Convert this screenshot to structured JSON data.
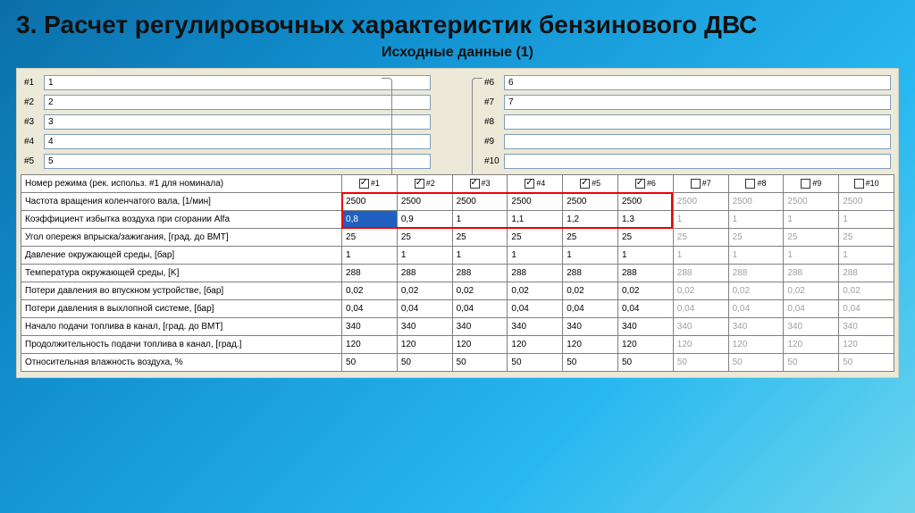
{
  "title": "3. Расчет регулировочных характеристик бензинового ДВС",
  "subtitle": "Исходные данные (1)",
  "left_inputs": [
    {
      "label": "#1",
      "value": "1"
    },
    {
      "label": "#2",
      "value": "2"
    },
    {
      "label": "#3",
      "value": "3"
    },
    {
      "label": "#4",
      "value": "4"
    },
    {
      "label": "#5",
      "value": "5"
    }
  ],
  "right_inputs": [
    {
      "label": "#6",
      "value": "6"
    },
    {
      "label": "#7",
      "value": "7"
    },
    {
      "label": "#8",
      "value": ""
    },
    {
      "label": "#9",
      "value": ""
    },
    {
      "label": "#10",
      "value": ""
    }
  ],
  "columns": [
    {
      "label": "#1",
      "checked": true
    },
    {
      "label": "#2",
      "checked": true
    },
    {
      "label": "#3",
      "checked": true
    },
    {
      "label": "#4",
      "checked": true
    },
    {
      "label": "#5",
      "checked": true
    },
    {
      "label": "#6",
      "checked": true
    },
    {
      "label": "#7",
      "checked": false
    },
    {
      "label": "#8",
      "checked": false
    },
    {
      "label": "#9",
      "checked": false
    },
    {
      "label": "#10",
      "checked": false
    }
  ],
  "rows": [
    {
      "param": "Номер режима (рек. использ. #1 для номинала)",
      "vals": [
        "",
        "",
        "",
        "",
        "",
        "",
        "",
        "",
        "",
        ""
      ],
      "is_header": true
    },
    {
      "param": "Частота вращения коленчатого вала, [1/мин]",
      "vals": [
        "2500",
        "2500",
        "2500",
        "2500",
        "2500",
        "2500",
        "2500",
        "2500",
        "2500",
        "2500"
      ]
    },
    {
      "param": "Коэффициент избытка воздуха при сгорании Alfa",
      "vals": [
        "0,8",
        "0,9",
        "1",
        "1,1",
        "1,2",
        "1,3",
        "1",
        "1",
        "1",
        "1"
      ]
    },
    {
      "param": "Угол опережя впрыска/зажигания, [град. до ВМТ]",
      "vals": [
        "25",
        "25",
        "25",
        "25",
        "25",
        "25",
        "25",
        "25",
        "25",
        "25"
      ]
    },
    {
      "param": "Давление окружающей среды, [бар]",
      "vals": [
        "1",
        "1",
        "1",
        "1",
        "1",
        "1",
        "1",
        "1",
        "1",
        "1"
      ]
    },
    {
      "param": "Температура окружающей среды, [K]",
      "vals": [
        "288",
        "288",
        "288",
        "288",
        "288",
        "288",
        "288",
        "288",
        "288",
        "288"
      ]
    },
    {
      "param": "Потери давления во впускном устройстве, [бар]",
      "vals": [
        "0,02",
        "0,02",
        "0,02",
        "0,02",
        "0,02",
        "0,02",
        "0,02",
        "0,02",
        "0,02",
        "0,02"
      ]
    },
    {
      "param": "Потери давления в выхлопной системе, [бар]",
      "vals": [
        "0,04",
        "0,04",
        "0,04",
        "0,04",
        "0,04",
        "0,04",
        "0,04",
        "0,04",
        "0,04",
        "0,04"
      ]
    },
    {
      "param": "Начало подачи топлива в канал, [град. до ВМТ]",
      "vals": [
        "340",
        "340",
        "340",
        "340",
        "340",
        "340",
        "340",
        "340",
        "340",
        "340"
      ]
    },
    {
      "param": "Продолжительность подачи топлива в канал, [град.]",
      "vals": [
        "120",
        "120",
        "120",
        "120",
        "120",
        "120",
        "120",
        "120",
        "120",
        "120"
      ]
    },
    {
      "param": "Относительная влажность воздуха, %",
      "vals": [
        "50",
        "50",
        "50",
        "50",
        "50",
        "50",
        "50",
        "50",
        "50",
        "50"
      ]
    }
  ],
  "chart_data": {
    "type": "table",
    "title": "Исходные данные (1)",
    "columns": [
      "#1",
      "#2",
      "#3",
      "#4",
      "#5",
      "#6",
      "#7",
      "#8",
      "#9",
      "#10"
    ],
    "active_columns": [
      1,
      2,
      3,
      4,
      5,
      6
    ],
    "series": [
      {
        "name": "Частота вращения коленчатого вала, [1/мин]",
        "values": [
          2500,
          2500,
          2500,
          2500,
          2500,
          2500,
          2500,
          2500,
          2500,
          2500
        ]
      },
      {
        "name": "Коэффициент избытка воздуха при сгорании Alfa",
        "values": [
          0.8,
          0.9,
          1,
          1.1,
          1.2,
          1.3,
          1,
          1,
          1,
          1
        ]
      },
      {
        "name": "Угол опережя впрыска/зажигания, [град. до ВМТ]",
        "values": [
          25,
          25,
          25,
          25,
          25,
          25,
          25,
          25,
          25,
          25
        ]
      },
      {
        "name": "Давление окружающей среды, [бар]",
        "values": [
          1,
          1,
          1,
          1,
          1,
          1,
          1,
          1,
          1,
          1
        ]
      },
      {
        "name": "Температура окружающей среды, [K]",
        "values": [
          288,
          288,
          288,
          288,
          288,
          288,
          288,
          288,
          288,
          288
        ]
      },
      {
        "name": "Потери давления во впускном устройстве, [бар]",
        "values": [
          0.02,
          0.02,
          0.02,
          0.02,
          0.02,
          0.02,
          0.02,
          0.02,
          0.02,
          0.02
        ]
      },
      {
        "name": "Потери давления в выхлопной системе, [бар]",
        "values": [
          0.04,
          0.04,
          0.04,
          0.04,
          0.04,
          0.04,
          0.04,
          0.04,
          0.04,
          0.04
        ]
      },
      {
        "name": "Начало подачи топлива в канал, [град. до ВМТ]",
        "values": [
          340,
          340,
          340,
          340,
          340,
          340,
          340,
          340,
          340,
          340
        ]
      },
      {
        "name": "Продолжительность подачи топлива в канал, [град.]",
        "values": [
          120,
          120,
          120,
          120,
          120,
          120,
          120,
          120,
          120,
          120
        ]
      },
      {
        "name": "Относительная влажность воздуха, %",
        "values": [
          50,
          50,
          50,
          50,
          50,
          50,
          50,
          50,
          50,
          50
        ]
      }
    ]
  }
}
